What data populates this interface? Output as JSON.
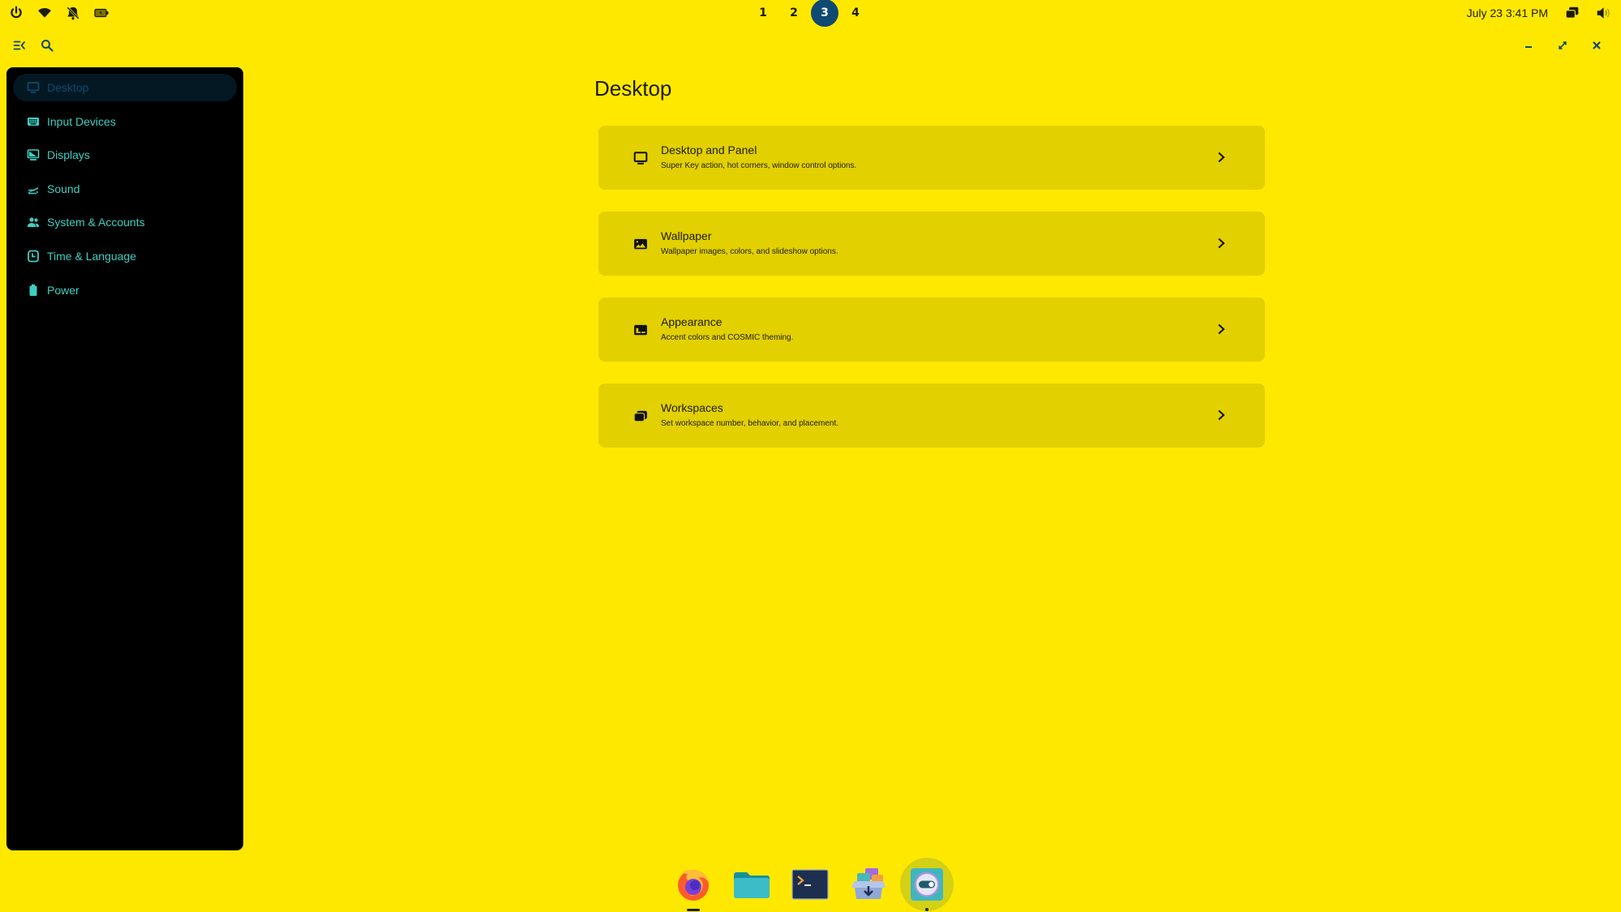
{
  "top_panel": {
    "left_icons": [
      {
        "name": "power-icon"
      },
      {
        "name": "wifi-icon"
      },
      {
        "name": "notifications-off-icon"
      },
      {
        "name": "battery-charging-icon"
      }
    ],
    "workspaces": [
      "1",
      "2",
      "3",
      "4"
    ],
    "active_workspace": "3",
    "clock": "July 23 3:41 PM",
    "right_icons": [
      {
        "name": "workspaces-overview-icon"
      },
      {
        "name": "volume-icon"
      }
    ]
  },
  "header": {
    "sidebar_toggle": "sidebar-toggle",
    "search": "search"
  },
  "sidebar": {
    "items": [
      {
        "label": "Desktop",
        "icon": "monitor-icon",
        "active": true
      },
      {
        "label": "Input Devices",
        "icon": "keyboard-icon",
        "active": false
      },
      {
        "label": "Displays",
        "icon": "display-icon",
        "active": false
      },
      {
        "label": "Sound",
        "icon": "sound-icon",
        "active": false
      },
      {
        "label": "System & Accounts",
        "icon": "users-icon",
        "active": false
      },
      {
        "label": "Time & Language",
        "icon": "clock-icon",
        "active": false
      },
      {
        "label": "Power",
        "icon": "battery-icon",
        "active": false
      }
    ]
  },
  "main": {
    "title": "Desktop",
    "cards": [
      {
        "title": "Desktop and Panel",
        "desc": "Super Key action, hot corners, window control options.",
        "icon": "monitor-icon"
      },
      {
        "title": "Wallpaper",
        "desc": "Wallpaper images, colors, and slideshow options.",
        "icon": "image-icon"
      },
      {
        "title": "Appearance",
        "desc": "Accent colors and COSMIC theming.",
        "icon": "appearance-icon"
      },
      {
        "title": "Workspaces",
        "desc": "Set workspace number, behavior, and placement.",
        "icon": "workspaces-icon"
      }
    ]
  },
  "dock": {
    "apps": [
      {
        "name": "Firefox",
        "icon": "firefox-icon",
        "running": true
      },
      {
        "name": "Files",
        "icon": "folder-icon",
        "running": false
      },
      {
        "name": "Terminal",
        "icon": "terminal-icon",
        "running": false
      },
      {
        "name": "Store",
        "icon": "store-icon",
        "running": false
      },
      {
        "name": "Settings",
        "icon": "settings-icon",
        "running": true,
        "focused": true
      }
    ]
  },
  "colors": {
    "background": "#ffe800",
    "card": "#e2d000",
    "sidebar": "#000000",
    "sidebar_text": "#3fcfc1",
    "accent": "#0f4a73"
  }
}
